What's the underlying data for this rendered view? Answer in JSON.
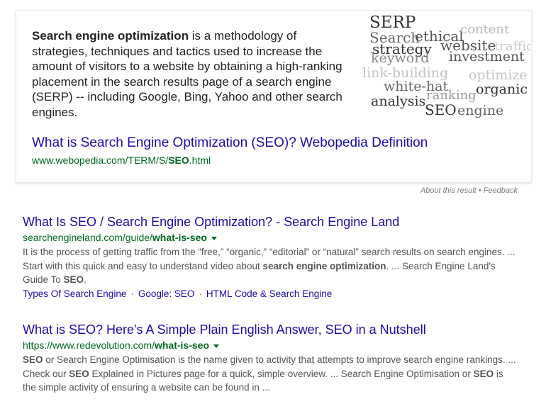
{
  "featured": {
    "term": "Search engine optimization",
    "definition": " is a methodology of strategies, techniques and tactics used to increase the amount of visitors to a website by obtaining a high-ranking placement in the search results page of a search engine (SERP) -- including Google, Bing, Yahoo and other search engines.",
    "title": "What is Search Engine Optimization (SEO)? Webopedia Definition",
    "url_prefix": "www.webopedia.com/TERM/S/",
    "url_bold": "SEO",
    "url_suffix": ".html",
    "wordcloud": [
      {
        "word": "SERP",
        "color": "#333333"
      },
      {
        "word": "Search",
        "color": "#666666"
      },
      {
        "word": "ethical",
        "color": "#555555"
      },
      {
        "word": "content",
        "color": "#bbbbbb"
      },
      {
        "word": "strategy",
        "color": "#333333"
      },
      {
        "word": "website",
        "color": "#555555"
      },
      {
        "word": "traffic",
        "color": "#cccccc"
      },
      {
        "word": "keyword",
        "color": "#888888"
      },
      {
        "word": "investment",
        "color": "#555555"
      },
      {
        "word": "link-building",
        "color": "#c4c4c4"
      },
      {
        "word": "optimize",
        "color": "#c4c4c4"
      },
      {
        "word": "white-hat",
        "color": "#666666"
      },
      {
        "word": "organic",
        "color": "#333333"
      },
      {
        "word": "ranking",
        "color": "#999999"
      },
      {
        "word": "analysis",
        "color": "#333333"
      },
      {
        "word": "SEO",
        "color": "#333333"
      },
      {
        "word": "engine",
        "color": "#666666"
      }
    ]
  },
  "about": {
    "about_label": "About this result",
    "separator": "•",
    "feedback_label": "Feedback"
  },
  "results": [
    {
      "title": "What Is SEO / Search Engine Optimization? - Search Engine Land",
      "url_prefix": "searchengineland.com/guide/",
      "url_bold": "what-is-seo",
      "snippet": [
        {
          "t": "It is the process of getting traffic from the “free,” “organic,” “editorial” or “natural” search results on search engines. ... Start with this quick and easy to understand video about ",
          "b": false
        },
        {
          "t": "search engine optimization",
          "b": true
        },
        {
          "t": ". ... Search Engine Land's Guide To ",
          "b": false
        },
        {
          "t": "SEO",
          "b": true
        },
        {
          "t": ".",
          "b": false
        }
      ],
      "sitelinks": [
        "Types Of Search Engine",
        "Google: SEO",
        "HTML Code & Search Engine"
      ],
      "sitelink_separator": "·"
    },
    {
      "title": "What is SEO? Here's A Simple Plain English Answer, SEO in a Nutshell",
      "url_prefix": "https://www.redevolution.com/",
      "url_bold": "what-is-seo",
      "snippet": [
        {
          "t": "SEO",
          "b": true
        },
        {
          "t": " or Search Engine Optimisation is the name given to activity that attempts to improve search engine rankings. ... Check our ",
          "b": false
        },
        {
          "t": "SEO",
          "b": true
        },
        {
          "t": " Explained in Pictures page for a quick, simple overview. ... Search Engine Optimisation or ",
          "b": false
        },
        {
          "t": "SEO",
          "b": true
        },
        {
          "t": " is the simple activity of ensuring a website can be found in ...",
          "b": false
        }
      ]
    }
  ]
}
